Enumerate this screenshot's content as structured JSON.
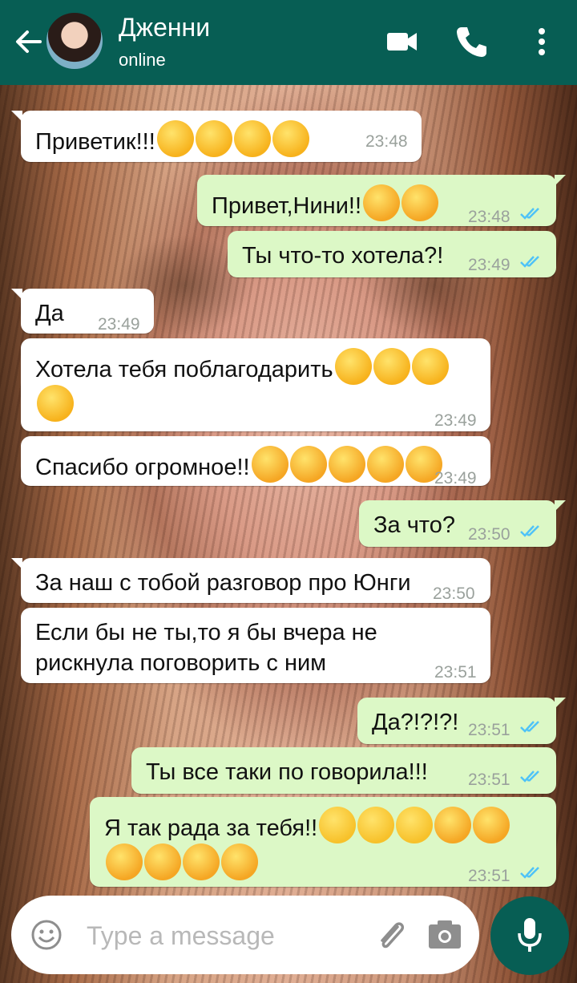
{
  "header": {
    "contact_name": "Дженни",
    "status": "online",
    "icons": [
      "back-arrow-icon",
      "avatar",
      "video-call-icon",
      "phone-icon",
      "more-vert-icon"
    ],
    "color": "#075e54"
  },
  "messages": [
    {
      "dir": "in",
      "text": "Приветик!!!",
      "emoji": [
        "hugging-face",
        "hugging-face",
        "hugging-face",
        "hugging-face"
      ],
      "time": "23:48"
    },
    {
      "dir": "out",
      "text": "Привет,Нини!!",
      "emoji": [
        "smiling-face",
        "smiling-face"
      ],
      "time": "23:48",
      "read": true
    },
    {
      "dir": "out",
      "text": "Ты что-то хотела?!",
      "emoji": [],
      "time": "23:49",
      "read": true
    },
    {
      "dir": "in",
      "text": "Да",
      "emoji": [],
      "time": "23:49"
    },
    {
      "dir": "in",
      "text": "Хотела тебя поблагодарить",
      "emoji": [
        "relieved-face",
        "relieved-face",
        "relieved-face",
        "relieved-face"
      ],
      "time": "23:49"
    },
    {
      "dir": "in",
      "text": "Спасибо огромное!!",
      "emoji": [
        "kissing-face",
        "kissing-face",
        "kissing-face",
        "kissing-face",
        "kissing-face"
      ],
      "time": "23:49"
    },
    {
      "dir": "out",
      "text": "За что?",
      "emoji": [],
      "time": "23:50",
      "read": true
    },
    {
      "dir": "in",
      "text": "За наш с тобой разговор про Юнги",
      "emoji": [],
      "time": "23:50"
    },
    {
      "dir": "in",
      "text": "Если бы не ты,то я бы вчера не рискнула поговорить с ним",
      "emoji": [],
      "time": "23:51"
    },
    {
      "dir": "out",
      "text": "Да?!?!?!",
      "emoji": [],
      "time": "23:51",
      "read": true
    },
    {
      "dir": "out",
      "text": "Ты все таки по говорила!!!",
      "emoji": [],
      "time": "23:51",
      "read": true
    },
    {
      "dir": "out",
      "text": "Я так рада за тебя!!",
      "emoji": [
        "grinning-face",
        "grinning-face",
        "grinning-face",
        "smiling-face",
        "smiling-face",
        "smiling-face",
        "kissing-face",
        "kissing-face",
        "kissing-face"
      ],
      "time": "23:51",
      "read": true
    }
  ],
  "composer": {
    "placeholder": "Type a message",
    "icons": [
      "emoji-icon",
      "attach-icon",
      "camera-icon",
      "mic-icon"
    ]
  },
  "colors": {
    "incoming": "#ffffff",
    "outgoing": "#dcf8c6",
    "read_check": "#4fc3f7"
  }
}
